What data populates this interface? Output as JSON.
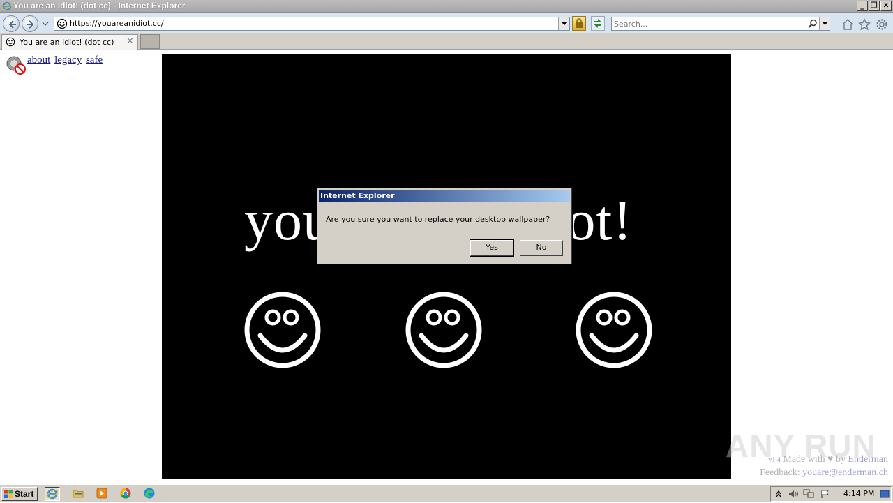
{
  "window": {
    "title": "You are an Idiot! (dot cc) - Internet Explorer",
    "min_label": "_",
    "restore_label": "❐",
    "close_label": "✕"
  },
  "navbar": {
    "url": "https://youareanidiot.cc/",
    "search_placeholder": "Search..."
  },
  "tab": {
    "label": "You are an Idiot! (dot cc)",
    "close_label": "✕"
  },
  "page": {
    "links": [
      "about",
      "legacy",
      "safe"
    ],
    "headline": "you are an idiot!",
    "footer": {
      "version": "v1.4",
      "made_text": "Made with",
      "by_text": "by",
      "author": "Enderman",
      "feedback_label": "Feedback:",
      "email": "youare@enderman.ch"
    },
    "watermark": "ANY RUN"
  },
  "dialog": {
    "title": "Internet Explorer",
    "message": "Are you sure you want to replace your desktop wallpaper?",
    "yes_label": "Yes",
    "no_label": "No"
  },
  "taskbar": {
    "start_label": "Start",
    "time": "4:14 PM"
  },
  "colors": {
    "stage_bg": "#000000",
    "dialog_title_start": "#0a246a",
    "dialog_title_end": "#a6caf0",
    "taskbar_bg": "#d4d0c8"
  }
}
